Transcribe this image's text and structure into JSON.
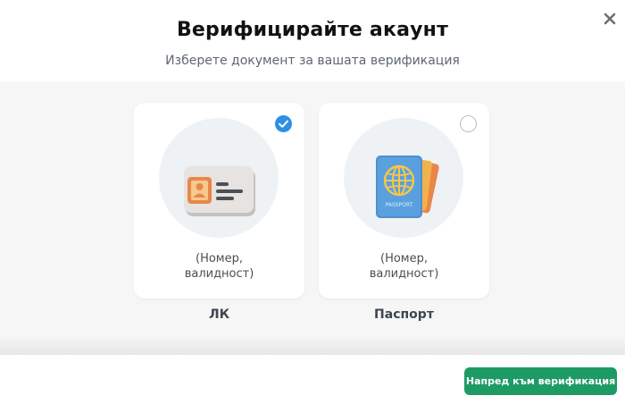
{
  "modal": {
    "title": "Верифицирайте акаунт",
    "subtitle": "Изберете документ за вашата верификация"
  },
  "options": [
    {
      "id": "id-card",
      "label": "ЛК",
      "description_line1": "(Номер,",
      "description_line2": "валидност)",
      "selected": true,
      "icon": "id-card-icon"
    },
    {
      "id": "passport",
      "label": "Паспорт",
      "description_line1": "(Номер,",
      "description_line2": "валидност)",
      "selected": false,
      "icon": "passport-icon",
      "icon_text": "PASSPORT"
    }
  ],
  "footer": {
    "next_label": "Напред към верификация"
  },
  "colors": {
    "accent": "#2f8ee5",
    "primary_button": "#1e9b64",
    "background": "#f6f6f6"
  }
}
